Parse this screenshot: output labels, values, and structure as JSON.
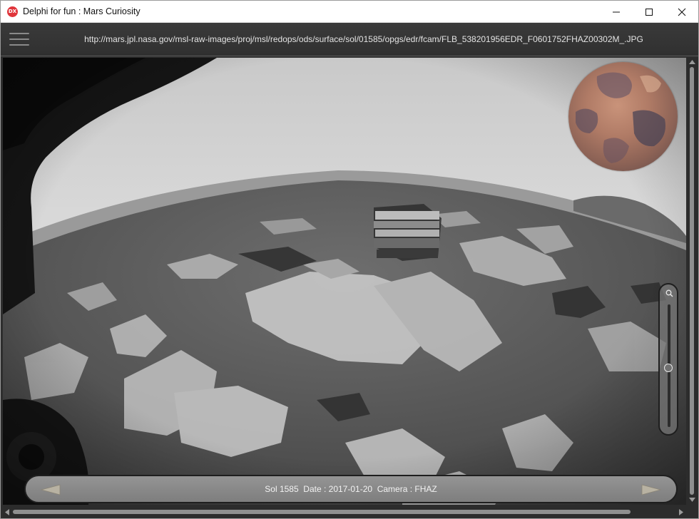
{
  "window": {
    "title": "Delphi for fun : Mars Curiosity",
    "app_icon": "DX"
  },
  "toolbar": {
    "menu_icon": "hamburger-menu-icon",
    "image_url": "http://mars.jpl.nasa.gov/msl-raw-images/proj/msl/redops/ods/surface/sol/01585/opgs/edr/fcam/FLB_538201956EDR_F0601752FHAZ00302M_.JPG"
  },
  "photo": {
    "description_kind": "hazcam-grayscale-terrain"
  },
  "zoom": {
    "icon": "magnifier-icon",
    "level": 0.52
  },
  "info": {
    "text": "Sol 1585  Date : 2017-01-20  Camera : FHAZ",
    "prev_icon": "arrow-left-icon",
    "next_icon": "arrow-right-icon"
  },
  "colors": {
    "accent_icon": "#e0353b",
    "toolbar_bg": "#333333",
    "infobar_bg": "#888888"
  }
}
